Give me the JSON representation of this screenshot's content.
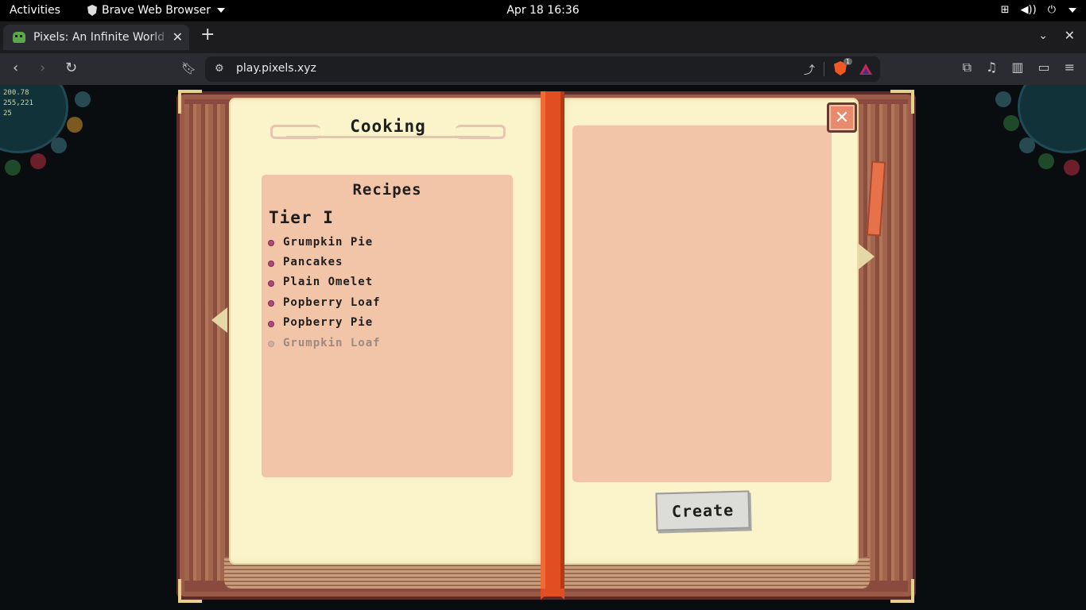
{
  "os": {
    "activities": "Activities",
    "app_name": "Brave Web Browser",
    "clock": "Apr 18  16:36"
  },
  "browser": {
    "tab_title": "Pixels: An Infinite World o",
    "url": "play.pixels.xyz",
    "shields_count": "1"
  },
  "hud": {
    "stat1": "200.78",
    "stat2": "255,221",
    "stat3": "25"
  },
  "book": {
    "title": "Cooking",
    "recipes_heading": "Recipes",
    "tier": "Tier I",
    "recipes": [
      {
        "name": "Grumpkin Pie",
        "available": true
      },
      {
        "name": "Pancakes",
        "available": true
      },
      {
        "name": "Plain Omelet",
        "available": true
      },
      {
        "name": "Popberry Loaf",
        "available": true
      },
      {
        "name": "Popberry Pie",
        "available": true
      },
      {
        "name": "Grumpkin Loaf",
        "available": false
      }
    ],
    "create_label": "Create"
  },
  "colors": {
    "page": "#fbf3c9",
    "panel": "#f2c4a8",
    "ribbon": "#e04e22",
    "cover": "#8a4a3d"
  }
}
